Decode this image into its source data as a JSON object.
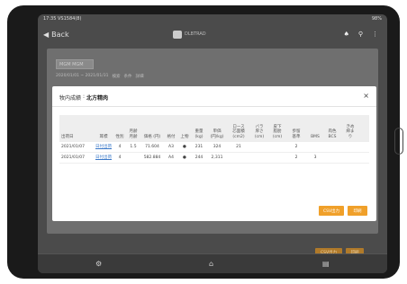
{
  "status_bar": {
    "time": "17:35 VS1584(8)",
    "battery": "98%"
  },
  "nav": {
    "back_label": "Back",
    "logo_text": "DLBTRAD",
    "bell": "♠",
    "search": "⚲",
    "more": "⋮"
  },
  "background": {
    "select_value": "MGM MGM",
    "date_range": "2020/01/01 ~ 2021/01/31",
    "filter_tags": [
      "検索",
      "条件",
      "詳細"
    ],
    "orange_buttons": [
      "CSV出力",
      "印刷"
    ]
  },
  "modal": {
    "title_label": "牧内成績",
    "title_separator": ":",
    "title_value": "北方精肉",
    "close_label": "×",
    "table": {
      "columns": [
        "出荷日",
        "耳標",
        "性別",
        "月齢\n月齢",
        "価格 (円)",
        "格付",
        "上物",
        "重量\n(kg)",
        "単価\n(円/kg)",
        "ロース\n芯面積\n(cm2)",
        "バラ\n厚さ\n(cm)",
        "皮下\n脂肪\n(cm)",
        "歩留\n基準",
        "BMS",
        "肉色\nBCS",
        "きめ\n締ま\nり"
      ],
      "rows": [
        [
          "2021/01/07",
          "日付出荷",
          "4",
          "1.5",
          "71.604",
          "A3",
          "●",
          "231",
          "324",
          "21",
          "",
          "",
          "2",
          "",
          "",
          ""
        ],
        [
          "2021/01/07",
          "日付出荷",
          "4",
          "",
          "582.884",
          "A4",
          "●",
          "244",
          "2,311",
          "",
          "",
          "",
          "2",
          "3",
          "",
          ""
        ]
      ]
    },
    "buttons": {
      "csv": "CSV出力",
      "print": "印刷"
    }
  },
  "tab_bar": {
    "items": [
      "⚙",
      "⌂",
      "▤"
    ]
  }
}
